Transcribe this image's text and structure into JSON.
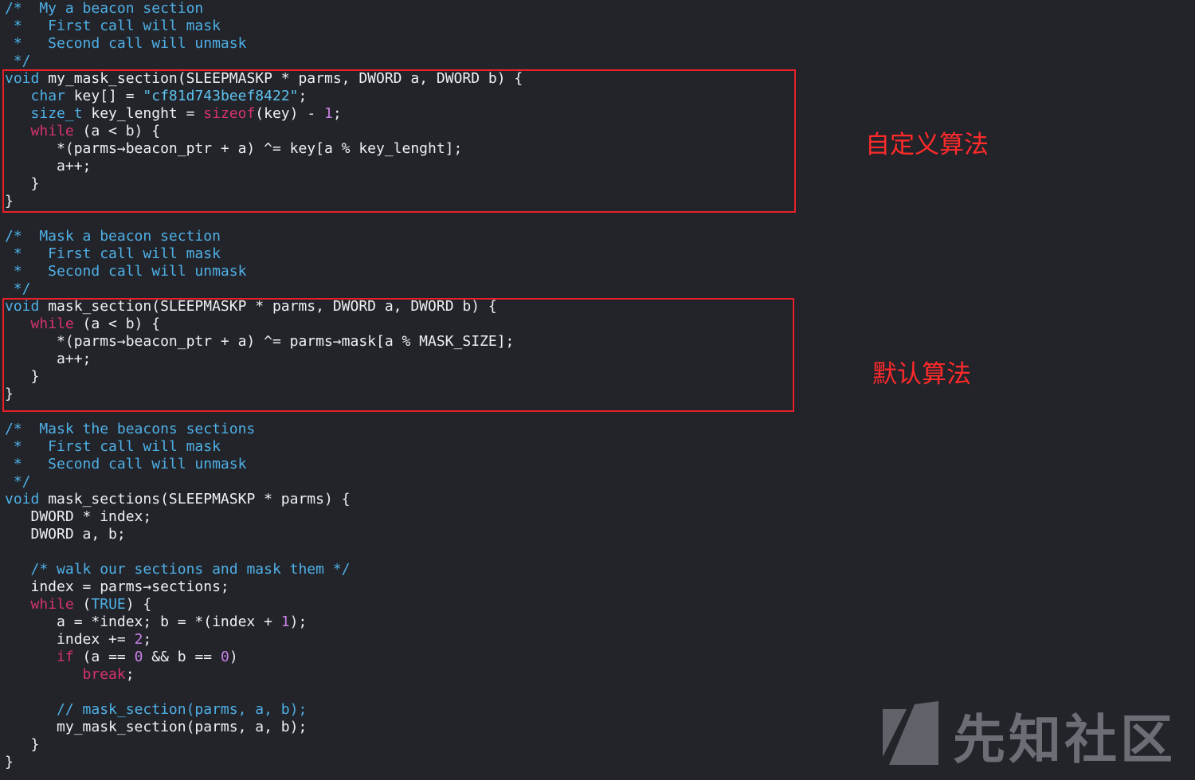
{
  "code_lines": [
    [
      {
        "t": "/*  My a beacon section",
        "c": "comment"
      }
    ],
    [
      {
        "t": " *   First call will mask",
        "c": "comment"
      }
    ],
    [
      {
        "t": " *   Second call will unmask",
        "c": "comment"
      }
    ],
    [
      {
        "t": " */",
        "c": "comment"
      }
    ],
    [
      {
        "t": "void",
        "c": "keyword"
      },
      {
        "t": " my_mask_section(SLEEPMASKP * parms, DWORD a, DWORD b) {",
        "c": "ident"
      }
    ],
    [
      {
        "t": "   ",
        "c": "ident"
      },
      {
        "t": "char",
        "c": "keyword"
      },
      {
        "t": " key[] = ",
        "c": "ident"
      },
      {
        "t": "\"cf81d743beef8422\"",
        "c": "string"
      },
      {
        "t": ";",
        "c": "ident"
      }
    ],
    [
      {
        "t": "   ",
        "c": "ident"
      },
      {
        "t": "size_t",
        "c": "keyword"
      },
      {
        "t": " key_lenght = ",
        "c": "ident"
      },
      {
        "t": "sizeof",
        "c": "ctrl"
      },
      {
        "t": "(key) - ",
        "c": "ident"
      },
      {
        "t": "1",
        "c": "num"
      },
      {
        "t": ";",
        "c": "ident"
      }
    ],
    [
      {
        "t": "   ",
        "c": "ident"
      },
      {
        "t": "while",
        "c": "ctrl"
      },
      {
        "t": " (a < b) {",
        "c": "ident"
      }
    ],
    [
      {
        "t": "      *(parms→beacon_ptr + a) ^= key[a % key_lenght];",
        "c": "ident"
      }
    ],
    [
      {
        "t": "      a++;",
        "c": "ident"
      }
    ],
    [
      {
        "t": "   }",
        "c": "ident"
      }
    ],
    [
      {
        "t": "}",
        "c": "ident"
      }
    ],
    [
      {
        "t": "",
        "c": "ident"
      }
    ],
    [
      {
        "t": "/*  Mask a beacon section",
        "c": "comment"
      }
    ],
    [
      {
        "t": " *   First call will mask",
        "c": "comment"
      }
    ],
    [
      {
        "t": " *   Second call will unmask",
        "c": "comment"
      }
    ],
    [
      {
        "t": " */",
        "c": "comment"
      }
    ],
    [
      {
        "t": "void",
        "c": "keyword"
      },
      {
        "t": " mask_section(SLEEPMASKP * parms, DWORD a, DWORD b) {",
        "c": "ident"
      }
    ],
    [
      {
        "t": "   ",
        "c": "ident"
      },
      {
        "t": "while",
        "c": "ctrl"
      },
      {
        "t": " (a < b) {",
        "c": "ident"
      }
    ],
    [
      {
        "t": "      *(parms→beacon_ptr + a) ^= parms→mask[a % MASK_SIZE];",
        "c": "ident"
      }
    ],
    [
      {
        "t": "      a++;",
        "c": "ident"
      }
    ],
    [
      {
        "t": "   }",
        "c": "ident"
      }
    ],
    [
      {
        "t": "}",
        "c": "ident"
      }
    ],
    [
      {
        "t": "",
        "c": "ident"
      }
    ],
    [
      {
        "t": "/*  Mask the beacons sections",
        "c": "comment"
      }
    ],
    [
      {
        "t": " *   First call will mask",
        "c": "comment"
      }
    ],
    [
      {
        "t": " *   Second call will unmask",
        "c": "comment"
      }
    ],
    [
      {
        "t": " */",
        "c": "comment"
      }
    ],
    [
      {
        "t": "void",
        "c": "keyword"
      },
      {
        "t": " mask_sections(SLEEPMASKP * parms) {",
        "c": "ident"
      }
    ],
    [
      {
        "t": "   DWORD * index;",
        "c": "ident"
      }
    ],
    [
      {
        "t": "   DWORD a, b;",
        "c": "ident"
      }
    ],
    [
      {
        "t": "",
        "c": "ident"
      }
    ],
    [
      {
        "t": "   ",
        "c": "ident"
      },
      {
        "t": "/* walk our sections and mask them */",
        "c": "comment"
      }
    ],
    [
      {
        "t": "   index = parms→sections;",
        "c": "ident"
      }
    ],
    [
      {
        "t": "   ",
        "c": "ident"
      },
      {
        "t": "while",
        "c": "ctrl"
      },
      {
        "t": " (",
        "c": "ident"
      },
      {
        "t": "TRUE",
        "c": "keyword"
      },
      {
        "t": ") {",
        "c": "ident"
      }
    ],
    [
      {
        "t": "      a = *index; b = *(index + ",
        "c": "ident"
      },
      {
        "t": "1",
        "c": "num"
      },
      {
        "t": ");",
        "c": "ident"
      }
    ],
    [
      {
        "t": "      index += ",
        "c": "ident"
      },
      {
        "t": "2",
        "c": "num"
      },
      {
        "t": ";",
        "c": "ident"
      }
    ],
    [
      {
        "t": "      ",
        "c": "ident"
      },
      {
        "t": "if",
        "c": "ctrl"
      },
      {
        "t": " (a == ",
        "c": "ident"
      },
      {
        "t": "0",
        "c": "num"
      },
      {
        "t": " && b == ",
        "c": "ident"
      },
      {
        "t": "0",
        "c": "num"
      },
      {
        "t": ")",
        "c": "ident"
      }
    ],
    [
      {
        "t": "         ",
        "c": "ident"
      },
      {
        "t": "break",
        "c": "ctrl"
      },
      {
        "t": ";",
        "c": "ident"
      }
    ],
    [
      {
        "t": "",
        "c": "ident"
      }
    ],
    [
      {
        "t": "      ",
        "c": "ident"
      },
      {
        "t": "// mask_section(parms, a, b);",
        "c": "comment"
      }
    ],
    [
      {
        "t": "      my_mask_section(parms, a, b);",
        "c": "ident"
      }
    ],
    [
      {
        "t": "   }",
        "c": "ident"
      }
    ],
    [
      {
        "t": "}",
        "c": "ident"
      }
    ]
  ],
  "annotations": {
    "custom_algorithm": "自定义算法",
    "default_algorithm": "默认算法"
  },
  "watermark": {
    "text": "先知社区",
    "logo_icon": "xianzhi-logo-icon"
  },
  "colors": {
    "background": "#22242a",
    "comment": "#4fb0e6",
    "control_keyword": "#d6336c",
    "number": "#c880e4",
    "highlight_box": "#e8202a"
  }
}
